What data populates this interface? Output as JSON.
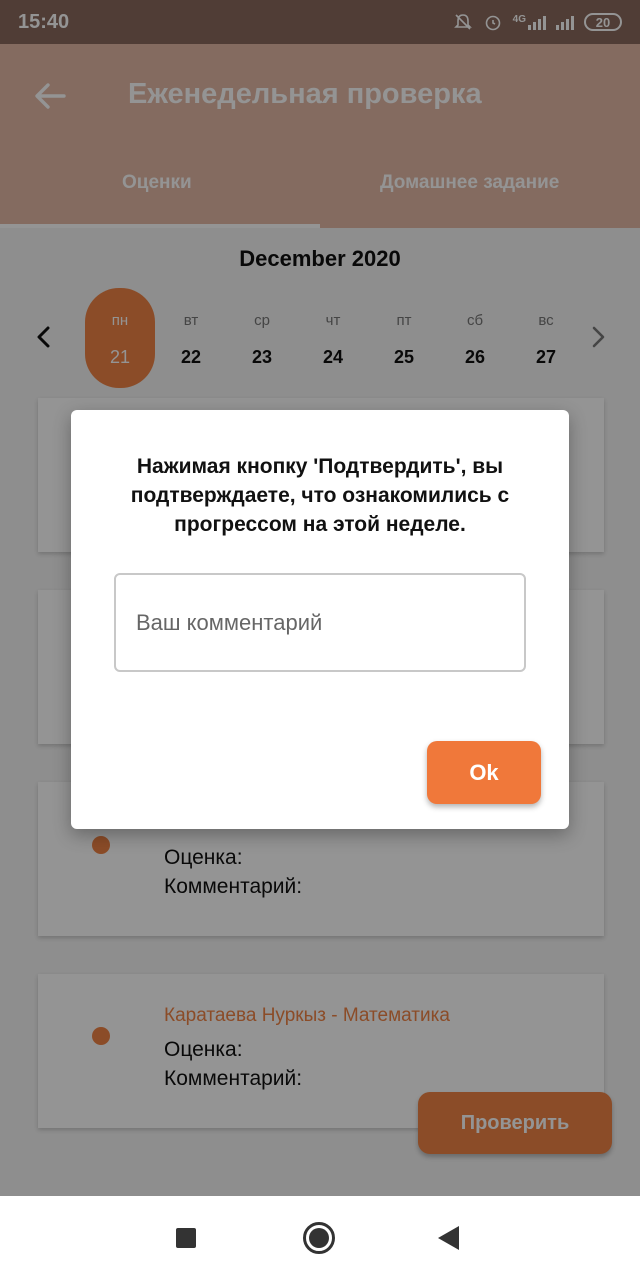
{
  "status_bar": {
    "time": "15:40",
    "network": "4G",
    "battery": "20"
  },
  "app_bar": {
    "title": "Еженедельная проверка",
    "tabs": [
      {
        "label": "Оценки",
        "active": true
      },
      {
        "label": "Домашнее задание",
        "active": false
      }
    ]
  },
  "calendar": {
    "month": "December 2020",
    "days": [
      {
        "dow": "пн",
        "num": "21",
        "selected": true
      },
      {
        "dow": "вт",
        "num": "22"
      },
      {
        "dow": "ср",
        "num": "23"
      },
      {
        "dow": "чт",
        "num": "24"
      },
      {
        "dow": "пт",
        "num": "25"
      },
      {
        "dow": "сб",
        "num": "26"
      },
      {
        "dow": "вс",
        "num": "27"
      }
    ]
  },
  "cards": [
    {
      "title": "",
      "grade_label": "Оценка:",
      "comment_label": "Комментарий:"
    },
    {
      "title": "Каратаева Нуркыз - Математика",
      "grade_label": "Оценка:",
      "comment_label": "Комментарий:"
    }
  ],
  "check_button": {
    "label": "Проверить"
  },
  "dialog": {
    "message": "Нажимая кнопку 'Подтвердить', вы подтверждаете, что ознакомились с прогрессом на этой неделе.",
    "comment_placeholder": "Ваш комментарий",
    "comment_value": "",
    "ok_label": "Ok"
  },
  "colors": {
    "accent": "#f08445",
    "ok_button": "#f0783a",
    "scrim": "rgba(0,0,0,0.42)"
  }
}
